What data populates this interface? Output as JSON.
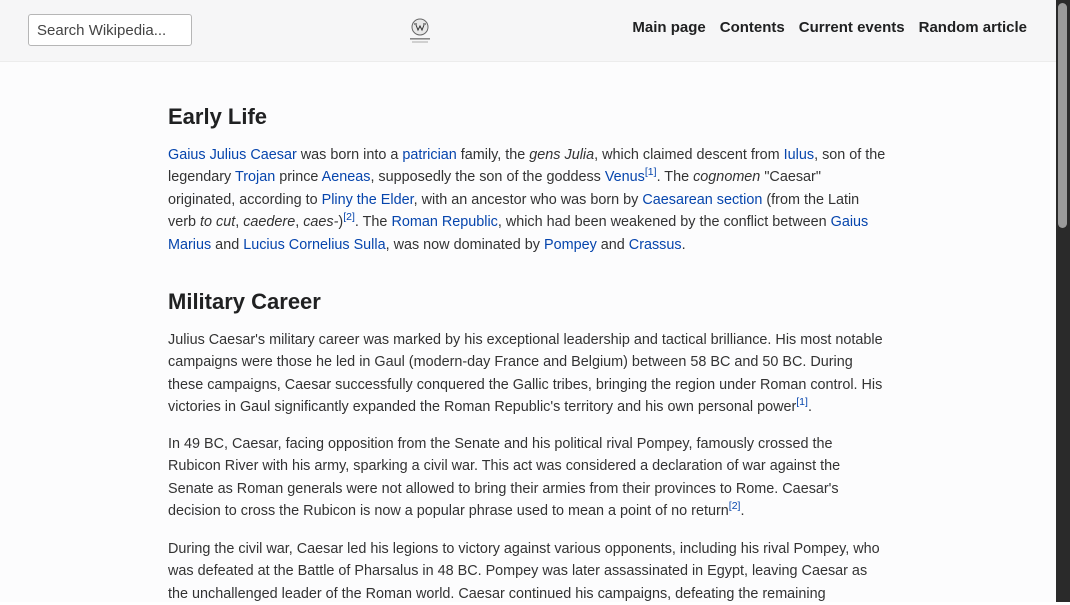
{
  "header": {
    "search_placeholder": "Search Wikipedia...",
    "logo_icon": "wikipedia-globe-icon",
    "nav": [
      "Main page",
      "Contents",
      "Current events",
      "Random article"
    ]
  },
  "sections": {
    "early": {
      "title": "Early Life",
      "p1": {
        "l_caesar": "Gaius Julius Caesar",
        "t1": " was born into a ",
        "l_patrician": "patrician",
        "t2": " family, the ",
        "i_gens": "gens Julia",
        "t3": ", which claimed descent from ",
        "l_iulus": "Iulus",
        "t4": ", son of the legendary ",
        "l_trojan": "Trojan",
        "t5": " prince ",
        "l_aeneas": "Aeneas",
        "t6": ", supposedly the son of the goddess ",
        "l_venus": "Venus",
        "ref1": "[1]",
        "t7": ". The ",
        "i_cognomen": "cognomen",
        "t8": " \"Caesar\" originated, according to ",
        "l_pliny": "Pliny the Elder",
        "t9": ", with an ancestor who was born by ",
        "l_section": "Caesarean section",
        "t10": " (from the Latin verb ",
        "i_tocut": "to cut",
        "t11": ", ",
        "i_caedere": "caedere",
        "t12": ", ",
        "i_caes": "caes-",
        "t13": ")",
        "ref2": "[2]",
        "t14": ". The ",
        "l_republic": "Roman Republic",
        "t15": ", which had been weakened by the conflict between ",
        "l_marius": "Gaius Marius",
        "t16": " and ",
        "l_sulla": "Lucius Cornelius Sulla",
        "t17": ", was now dominated by ",
        "l_pompey": "Pompey",
        "t18": " and ",
        "l_crassus": "Crassus",
        "t19": "."
      }
    },
    "military": {
      "title": "Military Career",
      "p1": "Julius Caesar's military career was marked by his exceptional leadership and tactical brilliance. His most notable campaigns were those he led in Gaul (modern-day France and Belgium) between 58 BC and 50 BC. During these campaigns, Caesar successfully conquered the Gallic tribes, bringing the region under Roman control. His victories in Gaul significantly expanded the Roman Republic's territory and his own personal power",
      "p1_ref": "[1]",
      "p1_end": ".",
      "p2": "In 49 BC, Caesar, facing opposition from the Senate and his political rival Pompey, famously crossed the Rubicon River with his army, sparking a civil war. This act was considered a declaration of war against the Senate as Roman generals were not allowed to bring their armies from their provinces to Rome. Caesar's decision to cross the Rubicon is now a popular phrase used to mean a point of no return",
      "p2_ref": "[2]",
      "p2_end": ".",
      "p3": "During the civil war, Caesar led his legions to victory against various opponents, including his rival Pompey, who was defeated at the Battle of Pharsalus in 48 BC. Pompey was later assassinated in Egypt, leaving Caesar as the unchallenged leader of the Roman world. Caesar continued his campaigns, defeating the remaining"
    }
  },
  "colors": {
    "link": "#0645ad",
    "header_bg": "#f6f6f7",
    "text": "#333333"
  }
}
